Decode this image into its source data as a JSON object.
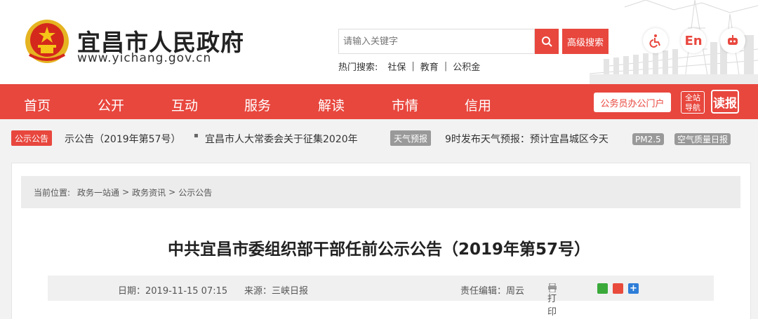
{
  "header": {
    "site_title": "宜昌市人民政府",
    "site_url": "www.yichang.gov.cn",
    "search_placeholder": "请输入关键字",
    "advanced_search": "高级搜索",
    "hot_label": "热门搜索:",
    "hot_items": [
      "社保",
      "教育",
      "公积金"
    ],
    "hot_sep": "|",
    "lang_button": "En"
  },
  "nav": {
    "items": [
      "首页",
      "公开",
      "互动",
      "服务",
      "解读",
      "市情",
      "信用"
    ],
    "portal": "公务员办公门户",
    "guide_line1": "全站",
    "guide_line2": "导航",
    "read": "读报"
  },
  "ticker": {
    "notice_tag": "公示公告",
    "notice_text1": "示公告（2019年第57号）",
    "bullet": "▪",
    "notice_text2": "宜昌市人大常委会关于征集2020年",
    "weather_tag": "天气预报",
    "weather_text": "9时发布天气预报：预计宜昌城区今天",
    "pm25": "PM2.5",
    "air_quality": "空气质量日报"
  },
  "breadcrumb": {
    "label": "当前位置:",
    "items": [
      "政务一站通",
      "政务资讯",
      "公示公告"
    ],
    "sep": ">"
  },
  "article": {
    "title": "中共宜昌市委组织部干部任前公示公告（2019年第57号）",
    "date": "日期：2019-11-15 07:15",
    "source": "来源：三峡日报",
    "editor": "责任编辑：周云",
    "print": "打印"
  },
  "colors": {
    "brand_red": "#e8473e",
    "gray_bar": "#ececec"
  }
}
